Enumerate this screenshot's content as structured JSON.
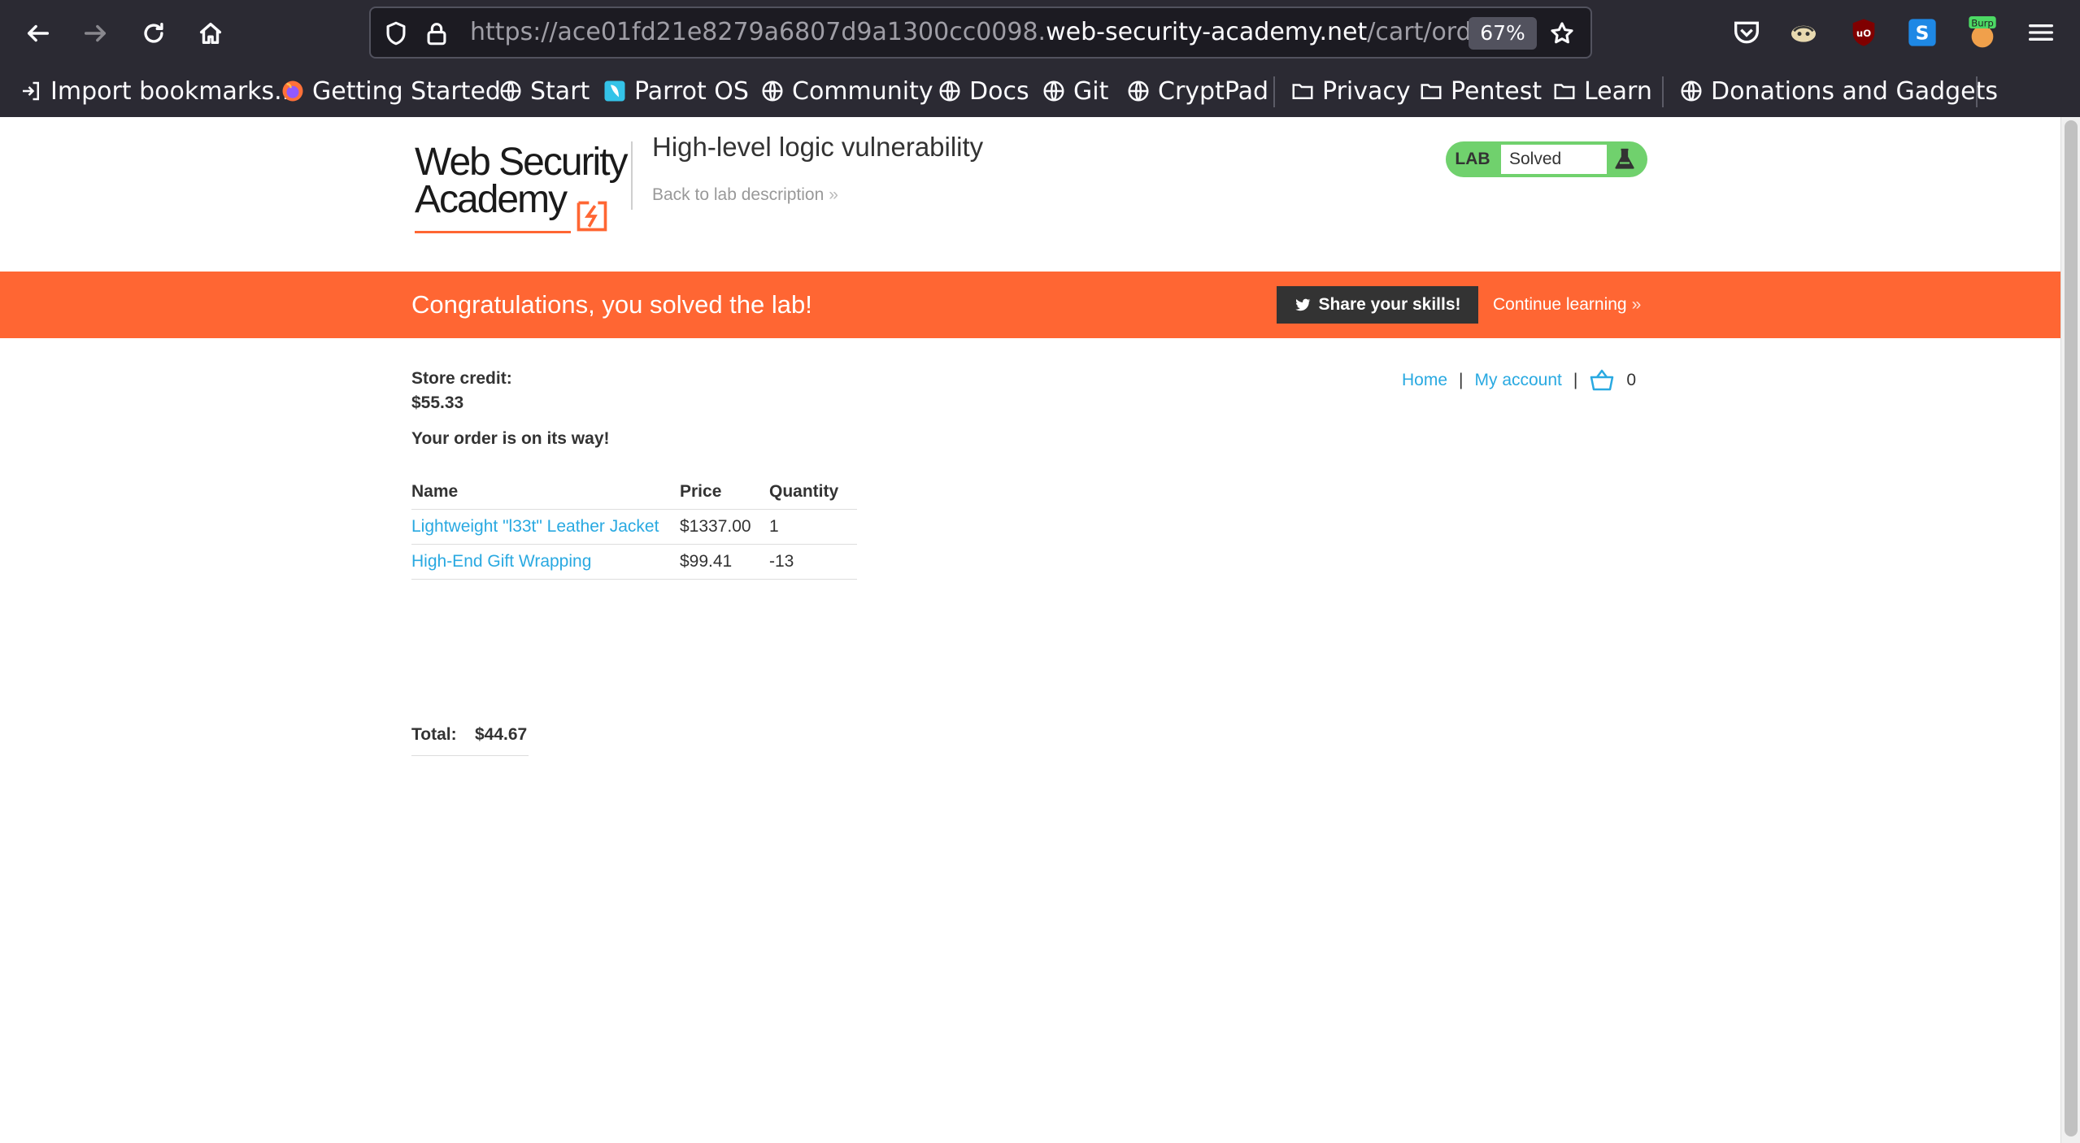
{
  "browser": {
    "url_prefix": "https://ace01fd21e8279a6807d9a1300cc0098.",
    "url_host": "web-security-academy.net",
    "url_path": "/cart/order-co",
    "zoom": "67%",
    "burp_badge": "Burp",
    "bookmarks": [
      {
        "label": "Import bookmarks...",
        "icon": "import-icon"
      },
      {
        "label": "Getting Started",
        "icon": "firefox-icon"
      },
      {
        "label": "Start",
        "icon": "globe-icon"
      },
      {
        "label": "Parrot OS",
        "icon": "parrot-icon"
      },
      {
        "label": "Community",
        "icon": "globe-icon"
      },
      {
        "label": "Docs",
        "icon": "globe-icon"
      },
      {
        "label": "Git",
        "icon": "globe-icon"
      },
      {
        "label": "CryptPad",
        "icon": "globe-icon"
      },
      {
        "label": "Privacy",
        "icon": "folder-icon"
      },
      {
        "label": "Pentest",
        "icon": "folder-icon"
      },
      {
        "label": "Learn",
        "icon": "folder-icon"
      },
      {
        "label": "Donations and Gadgets",
        "icon": "globe-icon"
      }
    ]
  },
  "header": {
    "logo_line1": "Web Security",
    "logo_line2": "Academy",
    "lab_title": "High-level logic vulnerability",
    "back_link": "Back to lab description",
    "lab_badge_label": "LAB",
    "lab_status": "Solved"
  },
  "banner": {
    "message": "Congratulations, you solved the lab!",
    "share_button": "Share your skills!",
    "continue_link": "Continue learning"
  },
  "nav": {
    "home": "Home",
    "sep": "|",
    "my_account": "My account",
    "cart_count": "0"
  },
  "store": {
    "credit_label": "Store credit:",
    "credit_value": "$55.33",
    "order_message": "Your order is on its way!"
  },
  "order": {
    "columns": [
      "Name",
      "Price",
      "Quantity"
    ],
    "rows": [
      {
        "name": "Lightweight \"l33t\" Leather Jacket",
        "price": "$1337.00",
        "quantity": "1"
      },
      {
        "name": "High-End Gift Wrapping",
        "price": "$99.41",
        "quantity": "-13"
      }
    ],
    "total_label": "Total:",
    "total_value": "$44.67"
  },
  "colors": {
    "accent_orange": "#ff6633",
    "link_blue": "#29a9e1",
    "lab_green": "#70d16d",
    "chrome_bg": "#2b2a33"
  }
}
